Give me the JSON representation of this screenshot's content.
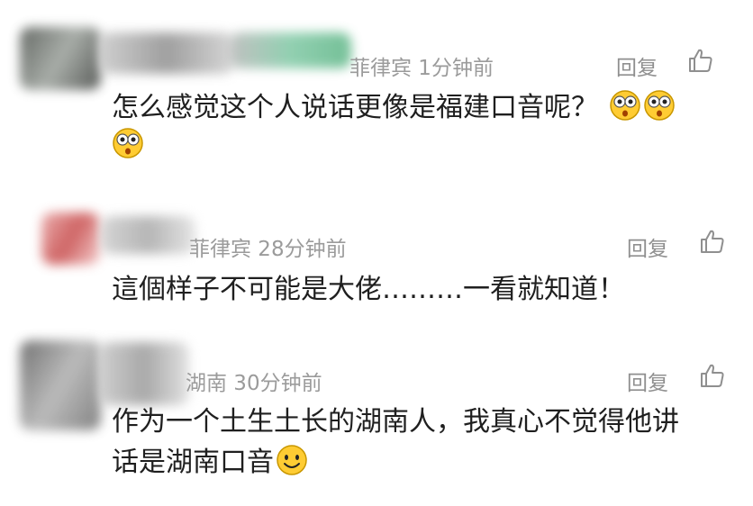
{
  "comments": [
    {
      "meta": "菲律宾 1分钟前",
      "reply": "回复",
      "text_line1": "怎么感觉这个人说话更像是福建口音呢？",
      "emoji": "shocked-emoji"
    },
    {
      "meta": "菲律宾 28分钟前",
      "reply": "回复",
      "text_line1": "這個样子不可能是大佬………一看就知道！"
    },
    {
      "meta": "湖南 30分钟前",
      "reply": "回复",
      "text_line1": "作为一个土生土长的湖南人，我真心不觉得他讲",
      "text_line2": "话是湖南口音",
      "emoji": "smile-emoji"
    }
  ],
  "colors": {
    "meta": "#9b9b9b",
    "text": "#1f1f1f",
    "emoji_face": "#ffcc33"
  },
  "icons": {
    "like": "thumbs-up-icon"
  }
}
